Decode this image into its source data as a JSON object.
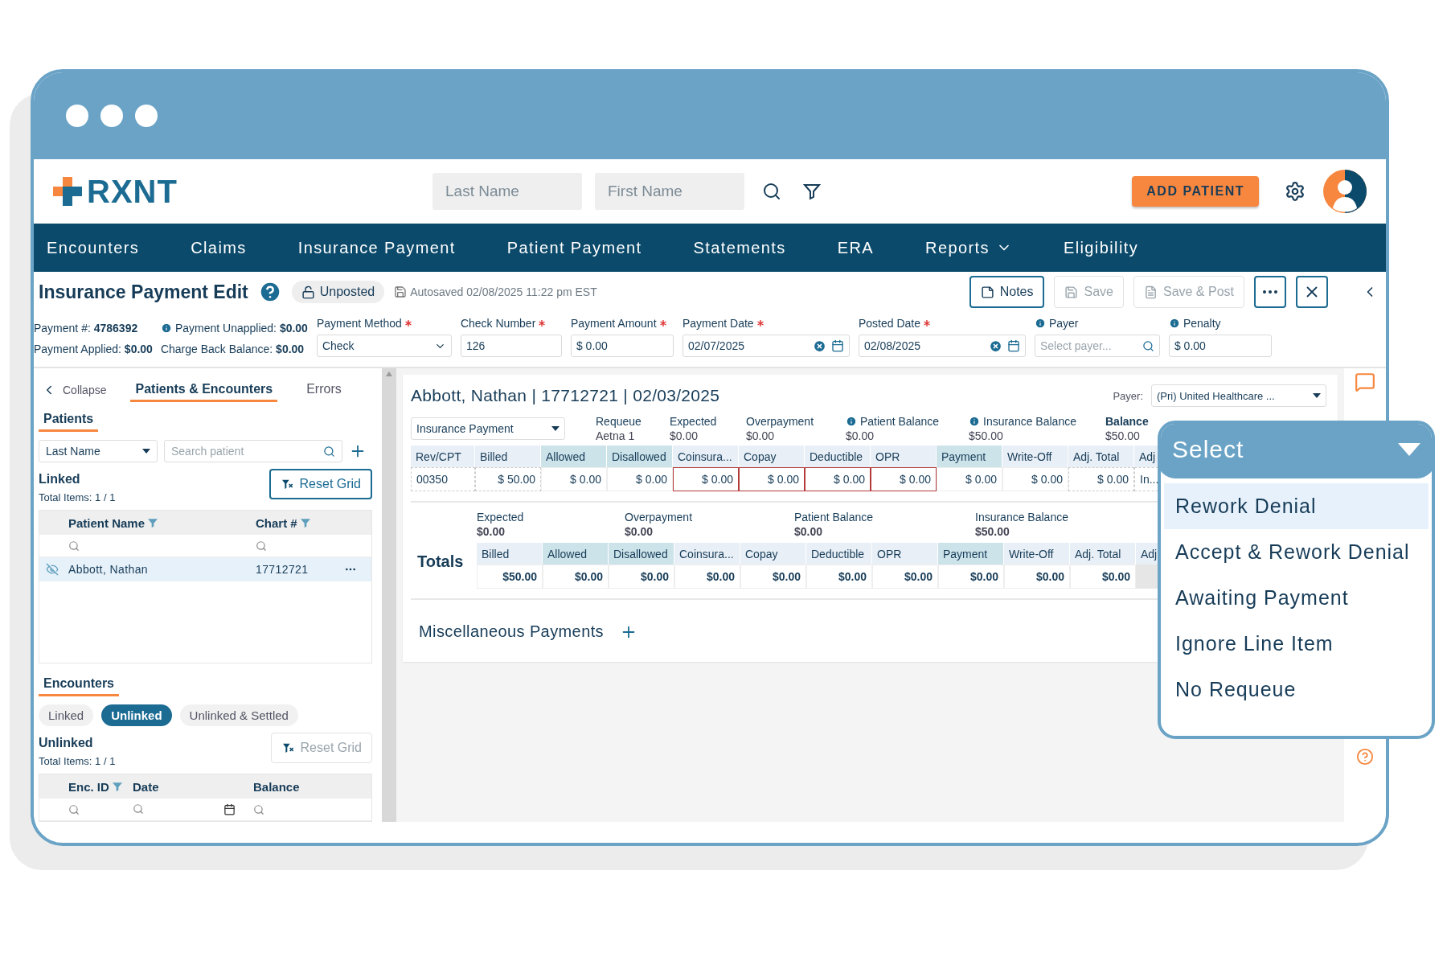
{
  "header": {
    "logo": "RXNT",
    "search_fields": [
      {
        "placeholder": "Last Name"
      },
      {
        "placeholder": "First Name"
      }
    ],
    "add_button": "ADD PATIENT"
  },
  "nav": [
    {
      "label": "Encounters",
      "has_menu": false
    },
    {
      "label": "Claims",
      "has_menu": false
    },
    {
      "label": "Insurance Payment",
      "has_menu": false
    },
    {
      "label": "Patient Payment",
      "has_menu": false
    },
    {
      "label": "Statements",
      "has_menu": false
    },
    {
      "label": "ERA",
      "has_menu": false
    },
    {
      "label": "Reports",
      "has_menu": true
    },
    {
      "label": "Eligibility",
      "has_menu": false
    }
  ],
  "toolbar": {
    "title": "Insurance Payment Edit",
    "status": "Unposted",
    "autosave": "Autosaved 02/08/2025 11:22 pm EST",
    "buttons": [
      {
        "label": "Notes",
        "kind": "notes",
        "disabled": false
      },
      {
        "label": "Save",
        "kind": "save",
        "disabled": true
      },
      {
        "label": "Save & Post",
        "kind": "post",
        "disabled": true
      }
    ]
  },
  "summary": [
    {
      "text": "Payment #: **4786392**",
      "info": false
    },
    {
      "text": "Payment Unapplied: **$0.00**",
      "info": true
    },
    {
      "text": "Payment Applied: **$0.00**",
      "info": false
    },
    {
      "text": "Charge Back Balance: **$0.00**",
      "info": false
    }
  ],
  "fields": [
    {
      "label": "Payment Method",
      "required": true,
      "info": false,
      "kind": "select",
      "value": "Check"
    },
    {
      "label": "Check Number",
      "required": true,
      "info": false,
      "kind": "text",
      "value": "126"
    },
    {
      "label": "Payment Amount",
      "required": true,
      "info": false,
      "kind": "text",
      "value": "$ 0.00"
    },
    {
      "label": "Payment Date",
      "required": true,
      "info": false,
      "kind": "date",
      "value": "02/07/2025"
    },
    {
      "label": "Posted Date",
      "required": true,
      "info": false,
      "kind": "date",
      "value": "02/08/2025"
    },
    {
      "label": "Payer",
      "required": false,
      "info": true,
      "kind": "search",
      "placeholder": "Select payer..."
    },
    {
      "label": "Penalty",
      "required": false,
      "info": true,
      "kind": "text",
      "value": "$ 0.00"
    }
  ],
  "left_panel": {
    "collapse": "Collapse",
    "tabs": [
      {
        "label": "Patients & Encounters",
        "selected": true
      },
      {
        "label": "Errors",
        "selected": false
      }
    ],
    "patients": {
      "heading": "Patients",
      "filter": "Last Name",
      "search_placeholder": "Search patient",
      "title": "Linked",
      "total": "Total Items: 1 / 1",
      "reset": {
        "label": "Reset Grid",
        "disabled": false
      },
      "columns": [
        {
          "label": "Patient Name",
          "filter": true
        },
        {
          "label": "Chart #",
          "filter": true
        }
      ],
      "rows": [
        {
          "name": "Abbott, Nathan",
          "chart": "17712721",
          "selected": true
        }
      ]
    },
    "encounters": {
      "heading": "Encounters",
      "segments": [
        {
          "label": "Linked",
          "selected": false
        },
        {
          "label": "Unlinked",
          "selected": true
        },
        {
          "label": "Unlinked & Settled",
          "selected": false
        }
      ],
      "title": "Unlinked",
      "total": "Total Items: 1 / 1",
      "reset": {
        "label": "Reset Grid",
        "disabled": true
      },
      "columns": [
        {
          "label": "Enc. ID",
          "filter": true
        },
        {
          "label": "Date",
          "filter": false
        },
        {
          "label": "Balance",
          "filter": false
        }
      ]
    }
  },
  "encounter": {
    "title": "Abbott, Nathan | 17712721 | 02/03/2025",
    "payer_label": "Payer:",
    "payer_value": "(Pri) United Healthcare ...",
    "type_select": "Insurance Payment",
    "stats": [
      {
        "label": "Requeue",
        "value": "Aetna 1",
        "info": false,
        "bold": false
      },
      {
        "label": "Expected",
        "value": "$0.00",
        "info": false,
        "bold": false
      },
      {
        "label": "Overpayment",
        "value": "$0.00",
        "info": false,
        "bold": false
      },
      {
        "label": "Patient Balance",
        "value": "$0.00",
        "info": true,
        "bold": false
      },
      {
        "label": "Insurance Balance",
        "value": "$50.00",
        "info": true,
        "bold": false
      },
      {
        "label": "Balance",
        "value": "$50.00",
        "info": false,
        "bold": true
      }
    ],
    "columns": [
      {
        "label": "Rev/CPT",
        "highlight": false
      },
      {
        "label": "Billed",
        "highlight": false
      },
      {
        "label": "Allowed",
        "highlight": true
      },
      {
        "label": "Disallowed",
        "highlight": true
      },
      {
        "label": "Coinsura...",
        "highlight": false
      },
      {
        "label": "Copay",
        "highlight": false
      },
      {
        "label": "Deductible",
        "highlight": false
      },
      {
        "label": "OPR",
        "highlight": false
      },
      {
        "label": "Payment",
        "highlight": true
      },
      {
        "label": "Write-Off",
        "highlight": false
      },
      {
        "label": "Adj. Total",
        "highlight": false
      },
      {
        "label": "Adj",
        "highlight": false
      }
    ],
    "rows": [
      {
        "cells": [
          {
            "text": "00350",
            "kind": "dashed"
          },
          {
            "text": "$ 50.00",
            "kind": "dashed"
          },
          {
            "text": "$ 0.00",
            "kind": "plain"
          },
          {
            "text": "$ 0.00",
            "kind": "plain"
          },
          {
            "text": "$ 0.00",
            "kind": "error"
          },
          {
            "text": "$ 0.00",
            "kind": "error"
          },
          {
            "text": "$ 0.00",
            "kind": "error"
          },
          {
            "text": "$ 0.00",
            "kind": "error"
          },
          {
            "text": "$ 0.00",
            "kind": "plain"
          },
          {
            "text": "$ 0.00",
            "kind": "plain"
          },
          {
            "text": "$ 0.00",
            "kind": "dashed"
          },
          {
            "text": "In...",
            "kind": "dashed"
          }
        ]
      }
    ],
    "totals": {
      "label": "Totals",
      "stats": [
        {
          "label": "Expected",
          "value": "$0.00"
        },
        {
          "label": "Overpayment",
          "value": "$0.00"
        },
        {
          "label": "Patient Balance",
          "value": "$0.00"
        },
        {
          "label": "Insurance Balance",
          "value": "$50.00"
        }
      ],
      "columns": [
        {
          "label": "Billed",
          "highlight": false
        },
        {
          "label": "Allowed",
          "highlight": true
        },
        {
          "label": "Disallowed",
          "highlight": true
        },
        {
          "label": "Coinsura...",
          "highlight": false
        },
        {
          "label": "Copay",
          "highlight": false
        },
        {
          "label": "Deductible",
          "highlight": false
        },
        {
          "label": "OPR",
          "highlight": false
        },
        {
          "label": "Payment",
          "highlight": true
        },
        {
          "label": "Write-Off",
          "highlight": false
        },
        {
          "label": "Adj. Total",
          "highlight": false
        },
        {
          "label": "Adj",
          "highlight": false
        }
      ],
      "values": [
        "$50.00",
        "$0.00",
        "$0.00",
        "$0.00",
        "$0.00",
        "$0.00",
        "$0.00",
        "$0.00",
        "$0.00",
        "$0.00"
      ]
    },
    "misc": "Miscellaneous Payments"
  },
  "dropdown": {
    "title": "Select",
    "options": [
      {
        "label": "Rework Denial",
        "selected": true
      },
      {
        "label": "Accept & Rework Denial",
        "selected": false
      },
      {
        "label": "Awaiting Payment",
        "selected": false
      },
      {
        "label": "Ignore Line Item",
        "selected": false
      },
      {
        "label": "No Requeue",
        "selected": false
      }
    ]
  }
}
